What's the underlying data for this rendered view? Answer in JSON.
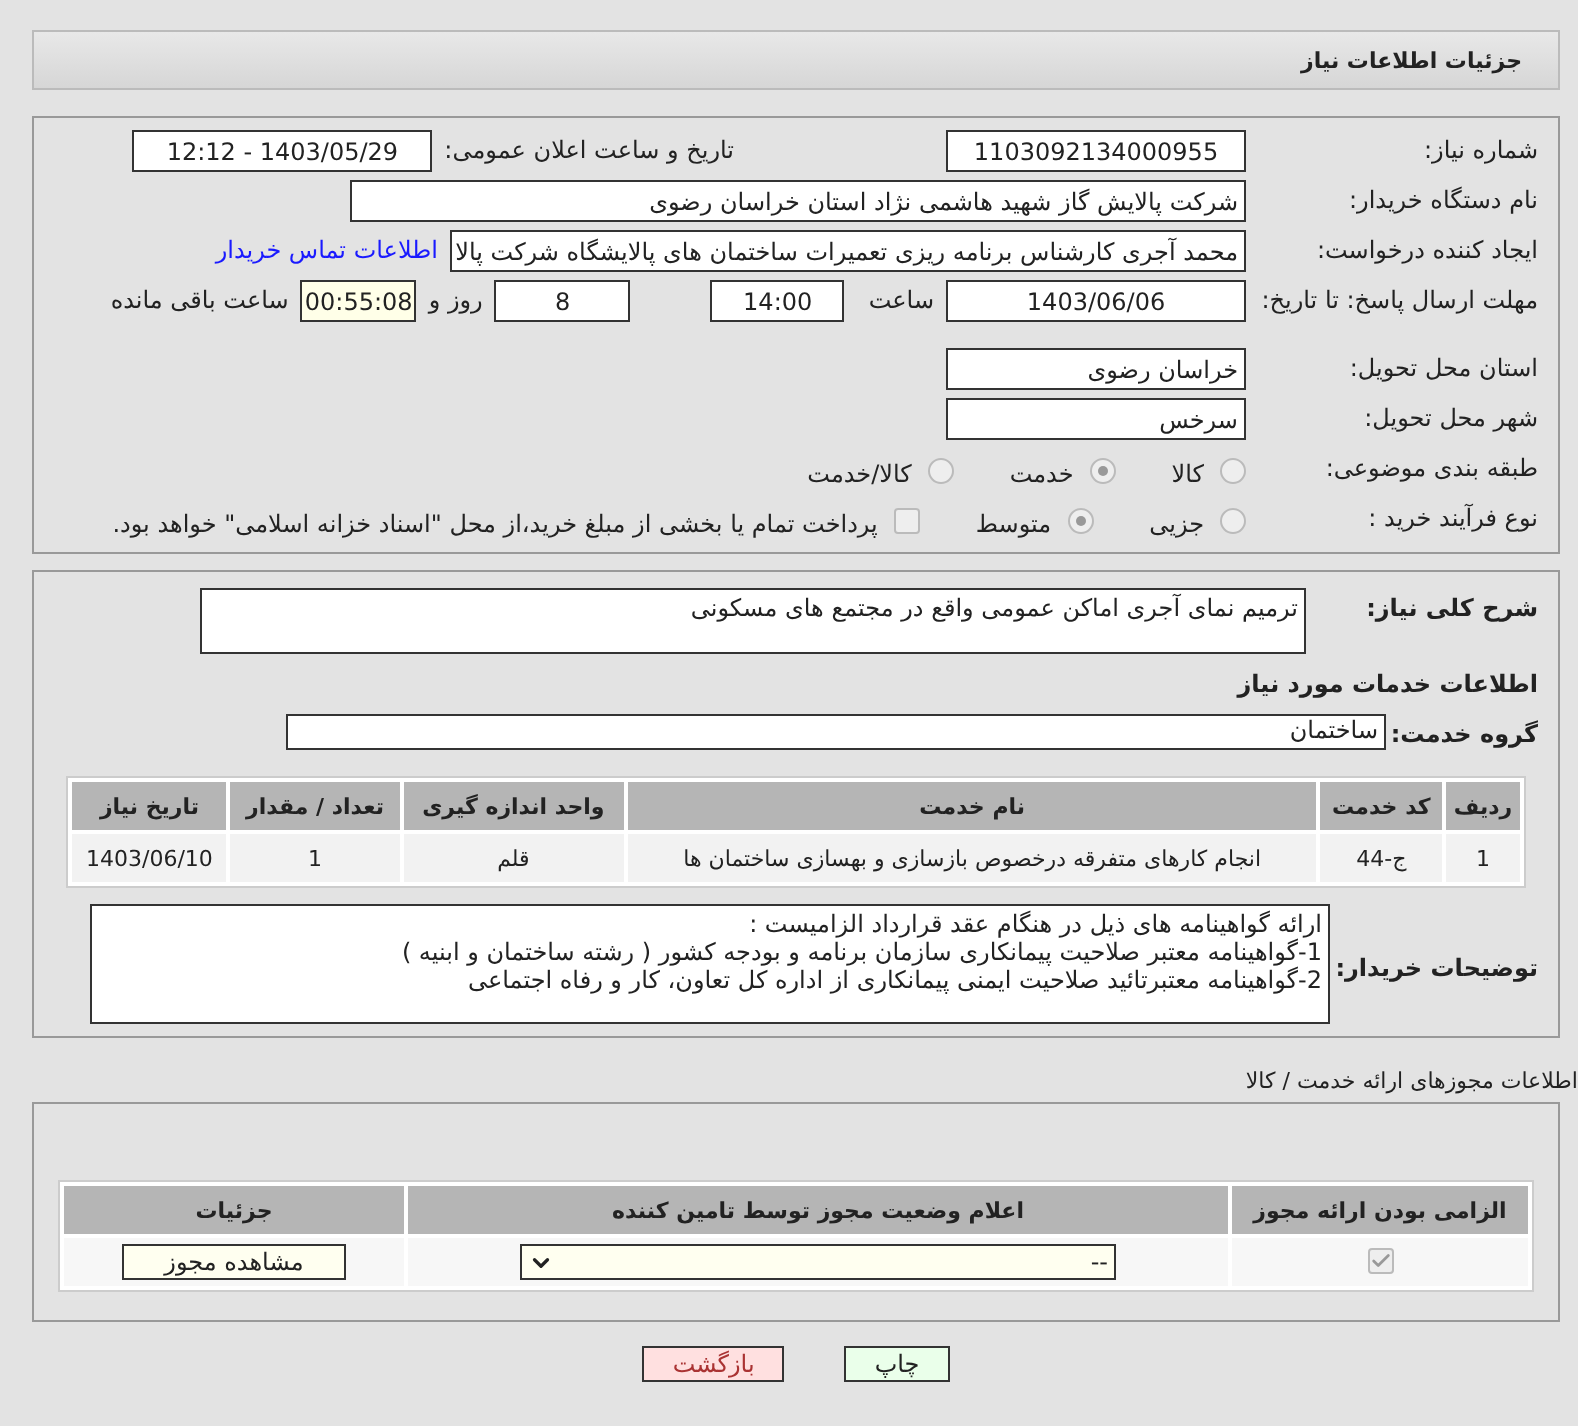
{
  "header": {
    "title": "جزئیات اطلاعات نیاز"
  },
  "details": {
    "need_number": {
      "label": "شماره نیاز:",
      "value": "1103092134000955"
    },
    "announce": {
      "label": "تاریخ و ساعت اعلان عمومی:",
      "value": "1403/05/29 - 12:12"
    },
    "buyer": {
      "label": "نام دستگاه خریدار:",
      "value": "شرکت پالایش گاز شهید هاشمی نژاد   استان خراسان رضوی"
    },
    "requester": {
      "label": "ایجاد کننده درخواست:",
      "value": "محمد آجری کارشناس برنامه ریزی تعمیرات ساختمان های پالایشگاه شرکت پالا",
      "link": "اطلاعات تماس خریدار"
    },
    "deadline": {
      "label": "مهلت ارسال پاسخ: تا تاریخ:",
      "date": "1403/06/06",
      "time_label": "ساعت",
      "time": "14:00",
      "days": "8",
      "days_label": "روز و",
      "remaining": "00:55:08",
      "remaining_label": "ساعت باقی مانده"
    },
    "province": {
      "label": "استان محل تحویل:",
      "value": "خراسان رضوی"
    },
    "city": {
      "label": "شهر محل تحویل:",
      "value": "سرخس"
    },
    "category": {
      "label": "طبقه بندی موضوعی:",
      "options": [
        {
          "label": "کالا",
          "selected": false
        },
        {
          "label": "خدمت",
          "selected": true
        },
        {
          "label": "کالا/خدمت",
          "selected": false
        }
      ]
    },
    "process": {
      "label": "نوع فرآیند خرید :",
      "options": [
        {
          "label": "جزیی",
          "selected": false
        },
        {
          "label": "متوسط",
          "selected": true
        }
      ],
      "payment": {
        "label": "پرداخت تمام یا بخشی از مبلغ خرید،از محل \"اسناد خزانه اسلامی\" خواهد بود.",
        "checked": false
      }
    }
  },
  "needs": {
    "description": {
      "label": "شرح کلی نیاز:",
      "value": "ترمیم نمای آجری اماکن عمومی واقع در مجتمع های مسکونی"
    },
    "services_title": "اطلاعات خدمات مورد نیاز",
    "service_group": {
      "label": "گروه خدمت:",
      "value": "ساختمان"
    },
    "table": {
      "columns": [
        "ردیف",
        "کد خدمت",
        "نام خدمت",
        "واحد اندازه گیری",
        "تعداد / مقدار",
        "تاریخ نیاز"
      ],
      "rows": [
        [
          "1",
          "ج-44",
          "انجام کارهای متفرقه درخصوص بازسازی و بهسازی ساختمان ها",
          "قلم",
          "1",
          "1403/06/10"
        ]
      ]
    },
    "buyer_notes": {
      "label": "توضیحات خریدار:",
      "lines": [
        "ارائه گواهینامه های ذیل در هنگام عقد قرارداد الزامیست :",
        "1-گواهینامه معتبر صلاحیت پیمانکاری سازمان برنامه و بودجه کشور ( رشته ساختمان و ابنیه )",
        "2-گواهینامه معتبرتائید صلاحیت ایمنی پیمانکاری از اداره کل تعاون، کار و رفاه اجتماعی"
      ]
    }
  },
  "permits": {
    "title": "اطلاعات مجوزهای ارائه خدمت / کالا",
    "columns": [
      "الزامی بودن ارائه مجوز",
      "اعلام وضعیت مجوز توسط تامین کننده",
      "جزئیات"
    ],
    "rows": [
      {
        "required": true,
        "status": "--",
        "button": "مشاهده مجوز"
      }
    ]
  },
  "buttons": [
    {
      "label": "چاپ",
      "kind": "print"
    },
    {
      "label": "بازگشت",
      "kind": "back"
    }
  ]
}
